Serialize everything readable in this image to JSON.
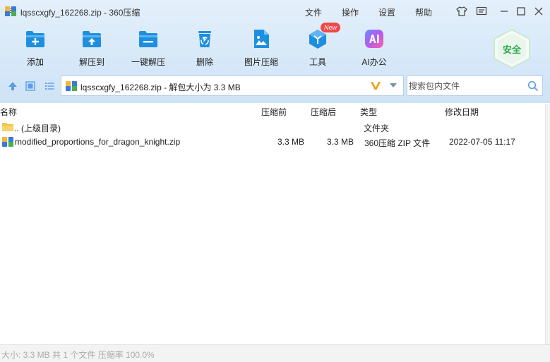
{
  "window": {
    "title": "lqsscxgfy_162268.zip - 360压缩",
    "menus": [
      "文件",
      "操作",
      "设置",
      "帮助"
    ]
  },
  "toolbar": {
    "tools": [
      "添加",
      "解压到",
      "一键解压",
      "删除",
      "图片压缩",
      "工具",
      "AI办公"
    ],
    "new_badge": "New",
    "safe_label": "安全"
  },
  "address": {
    "path_text": "lqsscxgfy_162268.zip - 解包大小为 3.3 MB"
  },
  "search": {
    "placeholder": "搜索包内文件"
  },
  "columns": {
    "name": "名称",
    "before": "压缩前",
    "after": "压缩后",
    "type": "类型",
    "modified": "修改日期"
  },
  "rows": [
    {
      "name": ".. (上级目录)",
      "before": "",
      "after": "",
      "type": "文件夹",
      "modified": ""
    },
    {
      "name": "modified_proportions_for_dragon_knight.zip",
      "before": "3.3 MB",
      "after": "3.3 MB",
      "type": "360压缩 ZIP 文件",
      "modified": "2022-07-05 11:17"
    }
  ],
  "status": {
    "text": "大小: 3.3 MB 共 1 个文件 压缩率 100.0%"
  },
  "colors": {
    "accent_blue": "#1e8fe0",
    "safe_green": "#2fa84f",
    "badge_red": "#f04848",
    "folder_yellow": "#f5c242"
  }
}
